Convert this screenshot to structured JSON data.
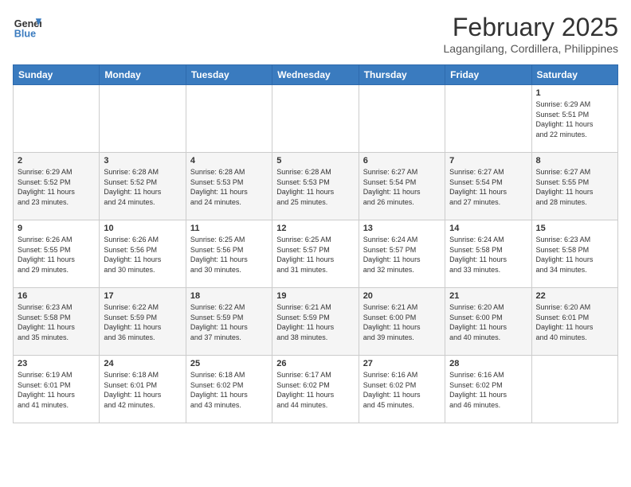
{
  "header": {
    "logo_general": "General",
    "logo_blue": "Blue",
    "month_title": "February 2025",
    "location": "Lagangilang, Cordillera, Philippines"
  },
  "days_of_week": [
    "Sunday",
    "Monday",
    "Tuesday",
    "Wednesday",
    "Thursday",
    "Friday",
    "Saturday"
  ],
  "weeks": [
    {
      "days": [
        {
          "num": "",
          "info": ""
        },
        {
          "num": "",
          "info": ""
        },
        {
          "num": "",
          "info": ""
        },
        {
          "num": "",
          "info": ""
        },
        {
          "num": "",
          "info": ""
        },
        {
          "num": "",
          "info": ""
        },
        {
          "num": "1",
          "info": "Sunrise: 6:29 AM\nSunset: 5:51 PM\nDaylight: 11 hours\nand 22 minutes."
        }
      ]
    },
    {
      "days": [
        {
          "num": "2",
          "info": "Sunrise: 6:29 AM\nSunset: 5:52 PM\nDaylight: 11 hours\nand 23 minutes."
        },
        {
          "num": "3",
          "info": "Sunrise: 6:28 AM\nSunset: 5:52 PM\nDaylight: 11 hours\nand 24 minutes."
        },
        {
          "num": "4",
          "info": "Sunrise: 6:28 AM\nSunset: 5:53 PM\nDaylight: 11 hours\nand 24 minutes."
        },
        {
          "num": "5",
          "info": "Sunrise: 6:28 AM\nSunset: 5:53 PM\nDaylight: 11 hours\nand 25 minutes."
        },
        {
          "num": "6",
          "info": "Sunrise: 6:27 AM\nSunset: 5:54 PM\nDaylight: 11 hours\nand 26 minutes."
        },
        {
          "num": "7",
          "info": "Sunrise: 6:27 AM\nSunset: 5:54 PM\nDaylight: 11 hours\nand 27 minutes."
        },
        {
          "num": "8",
          "info": "Sunrise: 6:27 AM\nSunset: 5:55 PM\nDaylight: 11 hours\nand 28 minutes."
        }
      ]
    },
    {
      "days": [
        {
          "num": "9",
          "info": "Sunrise: 6:26 AM\nSunset: 5:55 PM\nDaylight: 11 hours\nand 29 minutes."
        },
        {
          "num": "10",
          "info": "Sunrise: 6:26 AM\nSunset: 5:56 PM\nDaylight: 11 hours\nand 30 minutes."
        },
        {
          "num": "11",
          "info": "Sunrise: 6:25 AM\nSunset: 5:56 PM\nDaylight: 11 hours\nand 30 minutes."
        },
        {
          "num": "12",
          "info": "Sunrise: 6:25 AM\nSunset: 5:57 PM\nDaylight: 11 hours\nand 31 minutes."
        },
        {
          "num": "13",
          "info": "Sunrise: 6:24 AM\nSunset: 5:57 PM\nDaylight: 11 hours\nand 32 minutes."
        },
        {
          "num": "14",
          "info": "Sunrise: 6:24 AM\nSunset: 5:58 PM\nDaylight: 11 hours\nand 33 minutes."
        },
        {
          "num": "15",
          "info": "Sunrise: 6:23 AM\nSunset: 5:58 PM\nDaylight: 11 hours\nand 34 minutes."
        }
      ]
    },
    {
      "days": [
        {
          "num": "16",
          "info": "Sunrise: 6:23 AM\nSunset: 5:58 PM\nDaylight: 11 hours\nand 35 minutes."
        },
        {
          "num": "17",
          "info": "Sunrise: 6:22 AM\nSunset: 5:59 PM\nDaylight: 11 hours\nand 36 minutes."
        },
        {
          "num": "18",
          "info": "Sunrise: 6:22 AM\nSunset: 5:59 PM\nDaylight: 11 hours\nand 37 minutes."
        },
        {
          "num": "19",
          "info": "Sunrise: 6:21 AM\nSunset: 5:59 PM\nDaylight: 11 hours\nand 38 minutes."
        },
        {
          "num": "20",
          "info": "Sunrise: 6:21 AM\nSunset: 6:00 PM\nDaylight: 11 hours\nand 39 minutes."
        },
        {
          "num": "21",
          "info": "Sunrise: 6:20 AM\nSunset: 6:00 PM\nDaylight: 11 hours\nand 40 minutes."
        },
        {
          "num": "22",
          "info": "Sunrise: 6:20 AM\nSunset: 6:01 PM\nDaylight: 11 hours\nand 40 minutes."
        }
      ]
    },
    {
      "days": [
        {
          "num": "23",
          "info": "Sunrise: 6:19 AM\nSunset: 6:01 PM\nDaylight: 11 hours\nand 41 minutes."
        },
        {
          "num": "24",
          "info": "Sunrise: 6:18 AM\nSunset: 6:01 PM\nDaylight: 11 hours\nand 42 minutes."
        },
        {
          "num": "25",
          "info": "Sunrise: 6:18 AM\nSunset: 6:02 PM\nDaylight: 11 hours\nand 43 minutes."
        },
        {
          "num": "26",
          "info": "Sunrise: 6:17 AM\nSunset: 6:02 PM\nDaylight: 11 hours\nand 44 minutes."
        },
        {
          "num": "27",
          "info": "Sunrise: 6:16 AM\nSunset: 6:02 PM\nDaylight: 11 hours\nand 45 minutes."
        },
        {
          "num": "28",
          "info": "Sunrise: 6:16 AM\nSunset: 6:02 PM\nDaylight: 11 hours\nand 46 minutes."
        },
        {
          "num": "",
          "info": ""
        }
      ]
    }
  ]
}
